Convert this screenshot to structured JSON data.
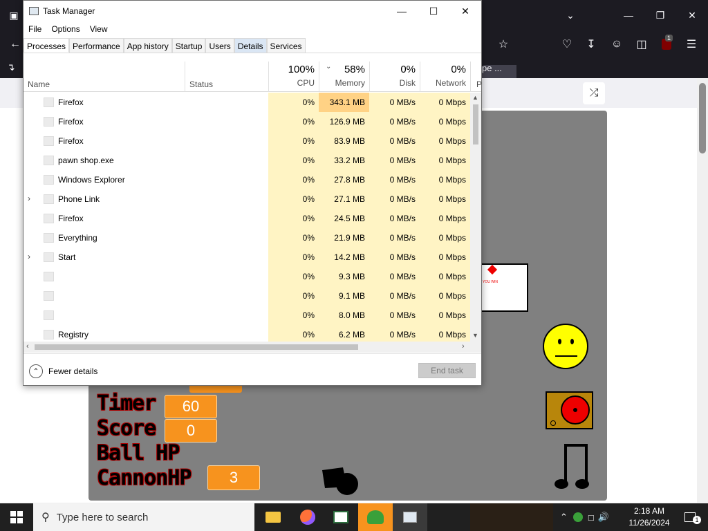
{
  "taskmanager": {
    "title": "Task Manager",
    "menu": [
      "File",
      "Options",
      "View"
    ],
    "tabs": [
      "Processes",
      "Performance",
      "App history",
      "Startup",
      "Users",
      "Details",
      "Services"
    ],
    "header": {
      "name": "Name",
      "status": "Status",
      "cpu_pct": "100%",
      "cpu": "CPU",
      "mem_pct": "58%",
      "mem": "Memory",
      "disk_pct": "0%",
      "disk": "Disk",
      "net_pct": "0%",
      "net": "Network",
      "more": "P"
    },
    "rows": [
      {
        "name": "Firefox",
        "cpu": "0%",
        "mem": "343.1 MB",
        "disk": "0 MB/s",
        "net": "0 Mbps"
      },
      {
        "name": "Firefox",
        "cpu": "0%",
        "mem": "126.9 MB",
        "disk": "0 MB/s",
        "net": "0 Mbps"
      },
      {
        "name": "Firefox",
        "cpu": "0%",
        "mem": "83.9 MB",
        "disk": "0 MB/s",
        "net": "0 Mbps"
      },
      {
        "name": "pawn shop.exe",
        "cpu": "0%",
        "mem": "33.2 MB",
        "disk": "0 MB/s",
        "net": "0 Mbps"
      },
      {
        "name": "Windows Explorer",
        "cpu": "0%",
        "mem": "27.8 MB",
        "disk": "0 MB/s",
        "net": "0 Mbps"
      },
      {
        "name": "Phone Link",
        "cpu": "0%",
        "mem": "27.1 MB",
        "disk": "0 MB/s",
        "net": "0 Mbps"
      },
      {
        "name": "Firefox",
        "cpu": "0%",
        "mem": "24.5 MB",
        "disk": "0 MB/s",
        "net": "0 Mbps"
      },
      {
        "name": "Everything",
        "cpu": "0%",
        "mem": "21.9 MB",
        "disk": "0 MB/s",
        "net": "0 Mbps"
      },
      {
        "name": "Start",
        "cpu": "0%",
        "mem": "14.2 MB",
        "disk": "0 MB/s",
        "net": "0 Mbps"
      },
      {
        "name": "",
        "cpu": "0%",
        "mem": "9.3 MB",
        "disk": "0 MB/s",
        "net": "0 Mbps"
      },
      {
        "name": "",
        "cpu": "0%",
        "mem": "9.1 MB",
        "disk": "0 MB/s",
        "net": "0 Mbps"
      },
      {
        "name": "",
        "cpu": "0%",
        "mem": "8.0 MB",
        "disk": "0 MB/s",
        "net": "0 Mbps"
      },
      {
        "name": "Registry",
        "cpu": "0%",
        "mem": "6.2 MB",
        "disk": "0 MB/s",
        "net": "0 Mbps"
      }
    ],
    "fewer_details": "Fewer details",
    "end_task": "End task"
  },
  "browser": {
    "partial_tab_text": "pe ..."
  },
  "game": {
    "labels": {
      "timer": "Timer",
      "score": "Score",
      "ballhp": "Ball HP",
      "cannonhp": "CannonHP"
    },
    "timer": "60",
    "score": "0",
    "cannonhp": "3",
    "paper_text": "YOU WIN"
  },
  "taskbar": {
    "search_placeholder": "Type here to search",
    "time": "2:18 AM",
    "date": "11/26/2024",
    "notif_count": "1"
  },
  "firefox_badge": "1",
  "colors": {
    "game_bg": "#808080",
    "value_box": "#f7931e",
    "heat_cell": "#fff4c4",
    "heat_top": "#ffd285"
  }
}
